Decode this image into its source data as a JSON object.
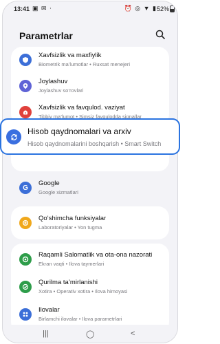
{
  "status": {
    "time": "13:41",
    "left_icons": "▣ ✉ ⋅",
    "right_icons": "⏰ ◎ ▼ ▮",
    "battery": "52%"
  },
  "header": {
    "title": "Parametrlar"
  },
  "cards": {
    "c1": [
      {
        "label": "Xavfsizlik va maxfiylik",
        "sub": "Biometrik ma’lumotlar  •  Ruxsat menejeri",
        "icon": "shield-icon",
        "color": "#3c6fd8"
      },
      {
        "label": "Joylashuv",
        "sub": "Joylashuv so‘rovlari",
        "icon": "location-icon",
        "color": "#5f63d6"
      },
      {
        "label": "Xavfsizlik va favqulod. vaziyat",
        "sub": "Tibbiy ma’lumot  •  Simsiz favqulodda signallar",
        "icon": "emergency-icon",
        "color": "#e0413c"
      }
    ],
    "highlight": {
      "label": "Hisob qaydnomalari va arxiv",
      "sub": "Hisob qaydnomalarini boshqarish  •  Smart Switch",
      "icon": "sync-icon",
      "color": "#3a6fe0"
    },
    "c2": [
      {
        "label": "Google",
        "sub": "Google xizmatlari",
        "icon": "google-icon",
        "color": "#3c6fd8"
      }
    ],
    "c3": [
      {
        "label": "Qo‘shimcha funksiyalar",
        "sub": "Laboratoriyalar  •  Yon tugma",
        "icon": "plus-gear-icon",
        "color": "#f0a81c"
      }
    ],
    "c4": [
      {
        "label": "Raqamli Salomatlik va ota-ona nazorati",
        "sub": "Ekran vaqti  •  Ilova taymerlari",
        "icon": "wellbeing-icon",
        "color": "#2e9d4a"
      },
      {
        "label": "Qurilma ta’mirlanishi",
        "sub": "Xotira  •  Operativ xotira  •  Ilova himoyasi",
        "icon": "device-care-icon",
        "color": "#2e9d4a"
      },
      {
        "label": "Ilovalar",
        "sub": "Birlamchi ilovalar  •  Ilova parametrlari",
        "icon": "apps-icon",
        "color": "#3c6fd8"
      }
    ]
  },
  "navbar": {
    "recents": "|||",
    "home": "◯",
    "back": "<"
  }
}
